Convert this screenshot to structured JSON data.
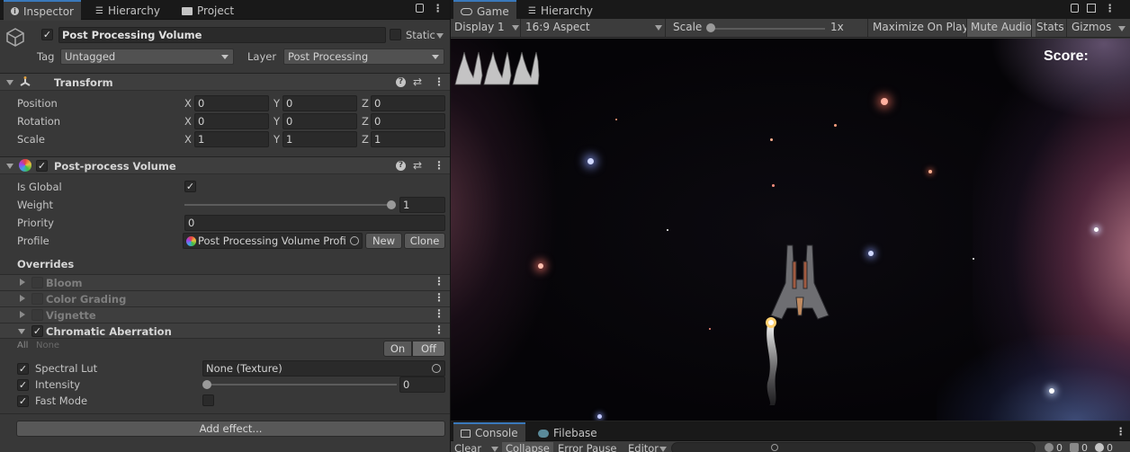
{
  "inspector": {
    "tabs": [
      {
        "label": "Inspector",
        "icon": "info-icon"
      },
      {
        "label": "Hierarchy",
        "icon": "list-icon"
      },
      {
        "label": "Project",
        "icon": "folder-icon"
      }
    ],
    "object_name": "Post Processing Volume",
    "static_label": "Static",
    "tag_label": "Tag",
    "tag_value": "Untagged",
    "layer_label": "Layer",
    "layer_value": "Post Processing",
    "transform": {
      "title": "Transform",
      "rows": [
        {
          "label": "Position",
          "x": "0",
          "y": "0",
          "z": "0"
        },
        {
          "label": "Rotation",
          "x": "0",
          "y": "0",
          "z": "0"
        },
        {
          "label": "Scale",
          "x": "1",
          "y": "1",
          "z": "1"
        }
      ],
      "axis_x": "X",
      "axis_y": "Y",
      "axis_z": "Z"
    },
    "volume": {
      "title": "Post-process Volume",
      "is_global_label": "Is Global",
      "weight_label": "Weight",
      "weight_value": "1",
      "weight_fraction": 1.0,
      "priority_label": "Priority",
      "priority_value": "0",
      "profile_label": "Profile",
      "profile_value": "Post Processing Volume Profi",
      "new_label": "New",
      "clone_label": "Clone"
    },
    "overrides": {
      "title": "Overrides",
      "effects": [
        "Bloom",
        "Color Grading",
        "Vignette",
        "Chromatic Aberration"
      ],
      "all_label": "All",
      "none_label": "None",
      "on_label": "On",
      "off_label": "Off",
      "spectral_lut_label": "Spectral Lut",
      "spectral_lut_value": "None (Texture)",
      "intensity_label": "Intensity",
      "intensity_value": "0",
      "fast_mode_label": "Fast Mode",
      "add_effect_label": "Add effect..."
    }
  },
  "game": {
    "tabs": [
      {
        "label": "Game",
        "icon": "gamepad-icon"
      },
      {
        "label": "Hierarchy",
        "icon": "list-icon"
      }
    ],
    "display_value": "Display 1",
    "aspect_value": "16:9 Aspect",
    "scale_label": "Scale",
    "scale_value": "1x",
    "maximize_label": "Maximize On Play",
    "mute_label": "Mute Audio",
    "stats_label": "Stats",
    "gizmos_label": "Gizmos",
    "score_label": "Score:",
    "lives": 3
  },
  "console": {
    "tabs": [
      {
        "label": "Console",
        "icon": "console-icon"
      },
      {
        "label": "Filebase",
        "icon": "firebase-icon"
      }
    ],
    "clear_label": "Clear",
    "collapse_label": "Collapse",
    "error_pause_label": "Error Pause",
    "editor_label": "Editor",
    "search_value": "",
    "info_count": "0",
    "warn_count": "0",
    "error_count": "0"
  }
}
